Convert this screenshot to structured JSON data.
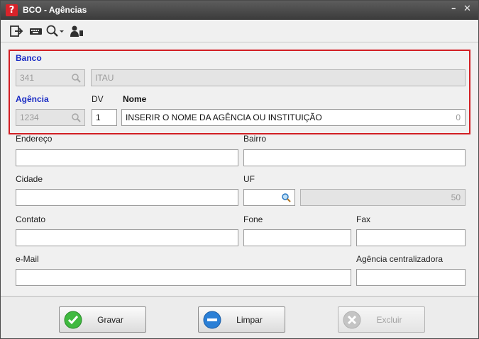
{
  "window": {
    "title": "BCO - Agências"
  },
  "toolbar": {
    "icons": [
      "exit-icon",
      "keyboard-icon",
      "search-icon",
      "user-icon"
    ]
  },
  "banco": {
    "label": "Banco",
    "code": "341",
    "name": "ITAU"
  },
  "agencia": {
    "label": "Agência",
    "code": "1234",
    "dv_label": "DV",
    "dv": "1",
    "nome_label": "Nome",
    "nome": "INSERIR O NOME DA AGÊNCIA OU INSTITUIÇÃO",
    "nome_counter": "0"
  },
  "fields": {
    "endereco_label": "Endereço",
    "endereco": "",
    "bairro_label": "Bairro",
    "bairro": "",
    "cidade_label": "Cidade",
    "cidade": "",
    "uf_label": "UF",
    "uf": "",
    "uf_counter": "50",
    "contato_label": "Contato",
    "contato": "",
    "fone_label": "Fone",
    "fone": "",
    "fax_label": "Fax",
    "fax": "",
    "email_label": "e-Mail",
    "email": "",
    "centralizadora_label": "Agência centralizadora",
    "centralizadora": ""
  },
  "buttons": {
    "gravar": "Gravar",
    "limpar": "Limpar",
    "excluir": "Excluir"
  },
  "colors": {
    "highlight": "#d21f24",
    "section_label": "#1a2cc4",
    "gravar_icon": "#3fb93f",
    "limpar_icon": "#2a7fd6",
    "excluir_icon": "#c4c4c4"
  }
}
